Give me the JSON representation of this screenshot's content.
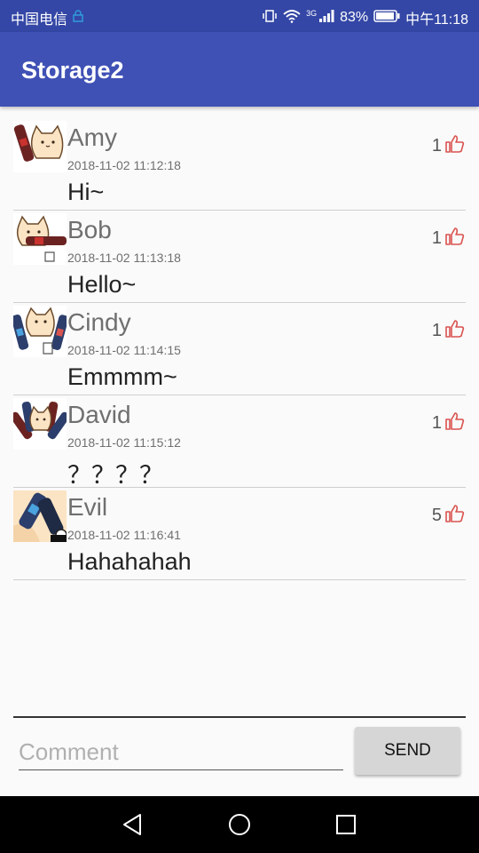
{
  "status_bar": {
    "carrier": "中国电信",
    "network": "3G",
    "battery": "83%",
    "time": "中午11:18"
  },
  "app": {
    "title": "Storage2"
  },
  "comments": [
    {
      "name": "Amy",
      "time": "2018-11-02 11:12:18",
      "message": "Hi~",
      "likes": "1"
    },
    {
      "name": "Bob",
      "time": "2018-11-02 11:13:18",
      "message": "Hello~",
      "likes": "1"
    },
    {
      "name": "Cindy",
      "time": "2018-11-02 11:14:15",
      "message": "Emmmm~",
      "likes": "1"
    },
    {
      "name": "David",
      "time": "2018-11-02 11:15:12",
      "message": "？？？？",
      "likes": "1"
    },
    {
      "name": "Evil",
      "time": "2018-11-02 11:16:41",
      "message": "Hahahahah",
      "likes": "5"
    }
  ],
  "composer": {
    "placeholder": "Comment",
    "send_label": "SEND"
  },
  "colors": {
    "primary": "#3f51b5",
    "status": "#3447a6",
    "like": "#d9534f"
  }
}
